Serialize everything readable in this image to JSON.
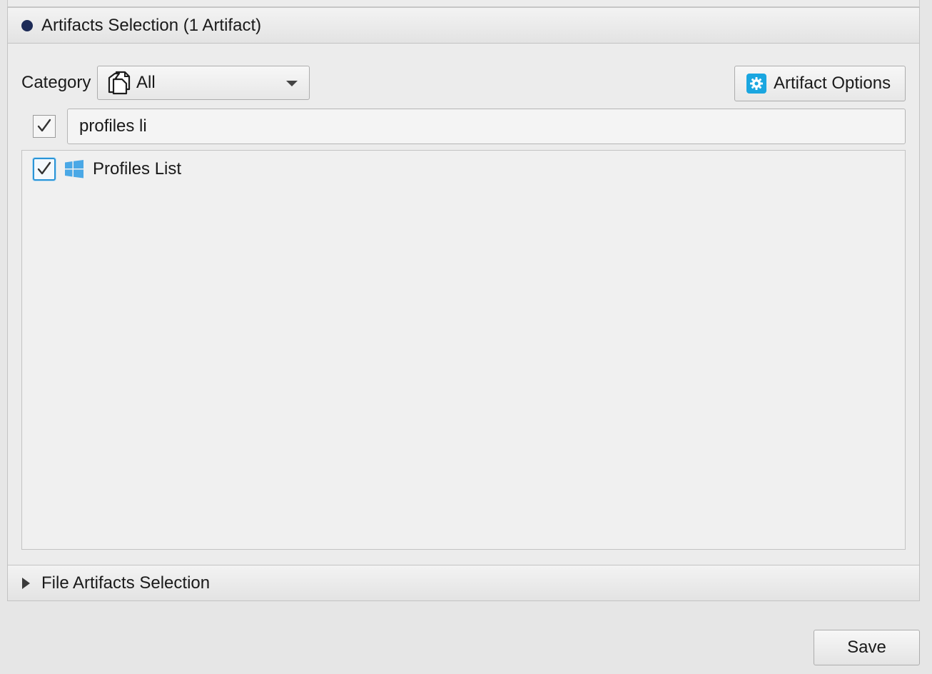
{
  "artifacts_section": {
    "title": "Artifacts Selection (1 Artifact)",
    "category_label": "Category",
    "category_value": "All",
    "artifact_options_label": "Artifact Options",
    "filter_checked": true,
    "search_value": "profiles li",
    "items": [
      {
        "label": "Profiles List",
        "checked": true,
        "icon": "windows-icon"
      }
    ]
  },
  "file_artifacts_section": {
    "title": "File Artifacts Selection",
    "expanded": false
  },
  "footer": {
    "save_label": "Save"
  },
  "colors": {
    "accent": "#2b94d6",
    "bullet": "#1d2b57",
    "gear_badge": "#1aa6e0",
    "windows_logo": "#4aa8e6"
  }
}
